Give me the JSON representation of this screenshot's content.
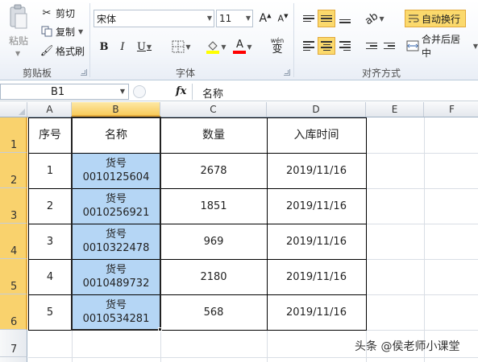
{
  "clipboard": {
    "paste_label": "粘贴",
    "cut_label": "剪切",
    "copy_label": "复制",
    "format_painter_label": "格式刷",
    "group_label": "剪贴板"
  },
  "font": {
    "font_name": "宋体",
    "font_size": "11",
    "bold": "B",
    "italic": "I",
    "underline": "U",
    "font_color_letter": "A",
    "phonetic_label": "wén",
    "phonetic_char": "变",
    "group_label": "字体",
    "fill_color": "#ffff00",
    "text_color": "#ff0000"
  },
  "alignment": {
    "wrap_text_label": "自动换行",
    "merge_center_label": "合并后居中",
    "group_label": "对齐方式"
  },
  "formula_bar": {
    "name_box": "B1",
    "fx_label": "fx",
    "content": "名称"
  },
  "columns": [
    "A",
    "B",
    "C",
    "D",
    "E",
    "F"
  ],
  "rows": [
    "1",
    "2",
    "3",
    "4",
    "5",
    "6",
    "7"
  ],
  "table": {
    "headers": [
      "序号",
      "名称",
      "数量",
      "入库时间"
    ],
    "rows": [
      {
        "seq": "1",
        "name_line1": "货号",
        "name_line2": "0010125604",
        "qty": "2678",
        "date": "2019/11/16"
      },
      {
        "seq": "2",
        "name_line1": "货号",
        "name_line2": "0010256921",
        "qty": "1851",
        "date": "2019/11/16"
      },
      {
        "seq": "3",
        "name_line1": "货号",
        "name_line2": "0010322478",
        "qty": "969",
        "date": "2019/11/16"
      },
      {
        "seq": "4",
        "name_line1": "货号",
        "name_line2": "0010489732",
        "qty": "2180",
        "date": "2019/11/16"
      },
      {
        "seq": "5",
        "name_line1": "货号",
        "name_line2": "0010534281",
        "qty": "568",
        "date": "2019/11/16"
      }
    ]
  },
  "watermark": "头条 @侯老师小课堂",
  "colors": {
    "selection_fill": "#b5d6f5",
    "selected_header": "#f9d26d",
    "active_button": "#fbd96c"
  }
}
